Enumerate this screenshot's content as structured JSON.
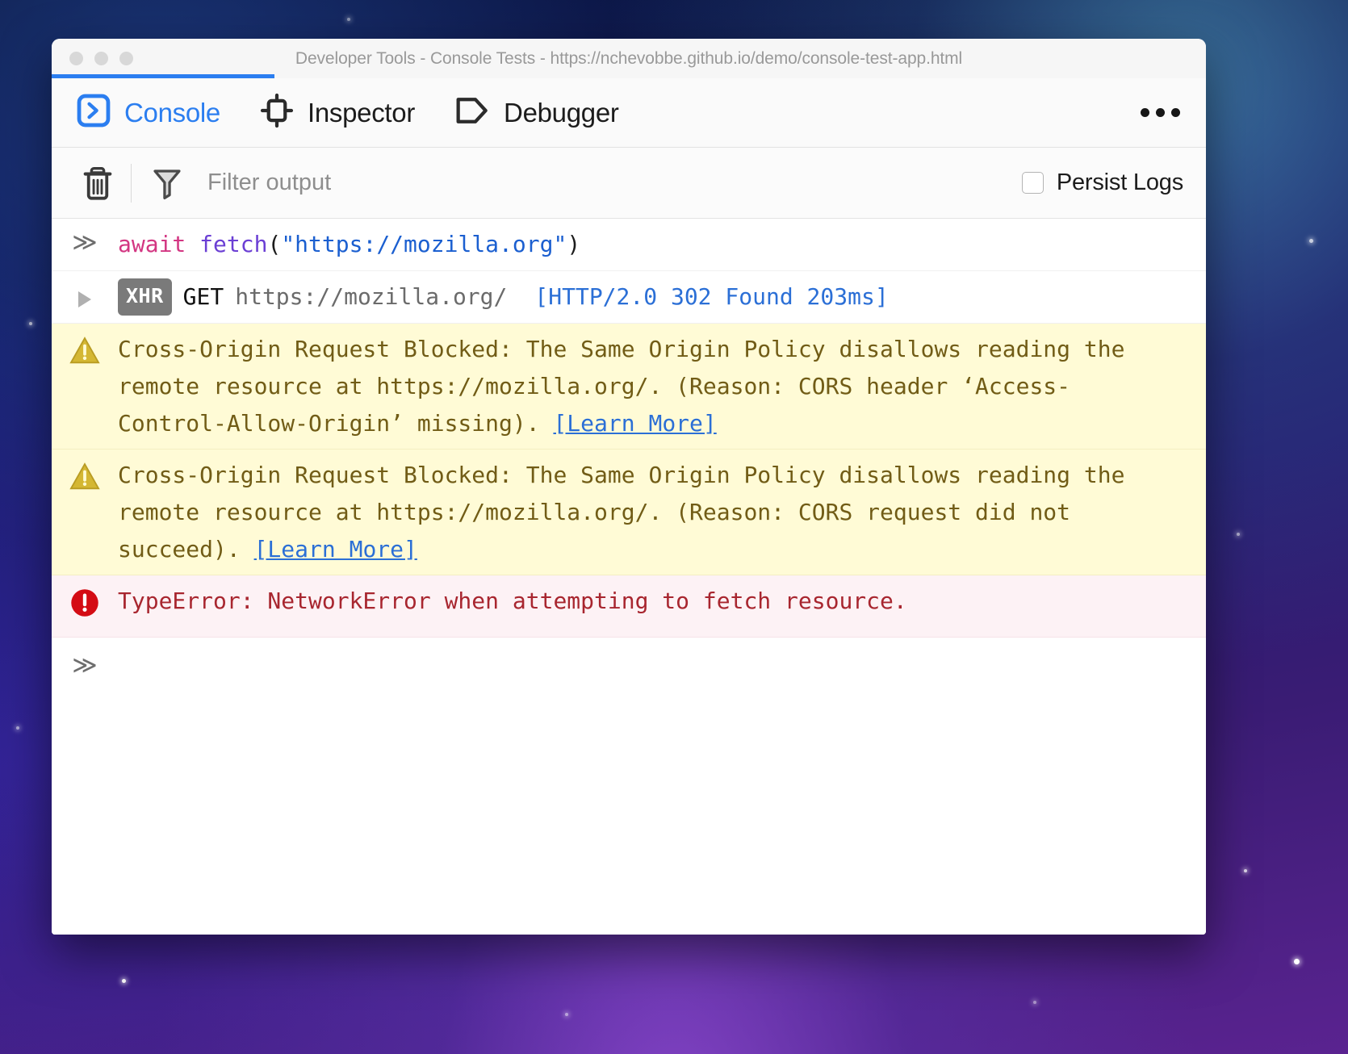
{
  "window": {
    "title": "Developer Tools - Console Tests - https://nchevobbe.github.io/demo/console-test-app.html",
    "traffic_lights": [
      "close",
      "minimize",
      "maximize"
    ]
  },
  "tabs": [
    {
      "id": "console",
      "label": "Console",
      "icon": "console-prompt-icon",
      "active": true
    },
    {
      "id": "inspector",
      "label": "Inspector",
      "icon": "inspector-box-icon",
      "active": false
    },
    {
      "id": "debugger",
      "label": "Debugger",
      "icon": "debugger-tag-icon",
      "active": false
    }
  ],
  "overflow_menu": {
    "icon": "ellipsis-icon",
    "label": "..."
  },
  "toolbar": {
    "clear_icon": "trash-icon",
    "filter_icon": "funnel-icon",
    "filter_placeholder": "Filter output",
    "filter_value": "",
    "persist_logs_label": "Persist Logs",
    "persist_logs_checked": false
  },
  "console": {
    "input_echo": {
      "prompt": "≫",
      "tokens": [
        {
          "type": "keyword",
          "text": "await "
        },
        {
          "type": "function",
          "text": "fetch"
        },
        {
          "type": "punct",
          "text": "("
        },
        {
          "type": "string",
          "text": "\"https://mozilla.org\""
        },
        {
          "type": "punct",
          "text": ")"
        }
      ]
    },
    "network_request": {
      "disclosure": "collapsed",
      "badge": "XHR",
      "method": "GET",
      "url": "https://mozilla.org/",
      "status": "[HTTP/2.0  302  Found 203ms]"
    },
    "messages": [
      {
        "level": "warning",
        "icon": "warning-triangle-icon",
        "text": "Cross-Origin Request Blocked: The Same Origin Policy disallows reading the remote resource at https://mozilla.org/. (Reason: CORS header ‘Access-Control-Allow-Origin’ missing).",
        "link": "[Learn More]"
      },
      {
        "level": "warning",
        "icon": "warning-triangle-icon",
        "text": "Cross-Origin Request Blocked: The Same Origin Policy disallows reading the remote resource at https://mozilla.org/. (Reason: CORS request did not succeed).",
        "link": "[Learn More]"
      },
      {
        "level": "error",
        "icon": "error-circle-icon",
        "text": "TypeError: NetworkError when attempting to fetch resource.",
        "link": ""
      }
    ],
    "input": {
      "prompt": "≫",
      "value": "",
      "placeholder": ""
    }
  },
  "colors": {
    "accent_blue": "#2b7ef0",
    "link_blue": "#2b6fd6",
    "warning_bg": "#fffbd6",
    "warning_fg": "#715c16",
    "warning_icon": "#d4b733",
    "error_bg": "#fdf2f5",
    "error_fg": "#a8262f",
    "error_icon": "#d40c14",
    "keyword_pink": "#d33682",
    "function_purple": "#6b3fd4",
    "string_blue": "#1b5fd0",
    "xhr_badge_bg": "#7a7a7a"
  }
}
